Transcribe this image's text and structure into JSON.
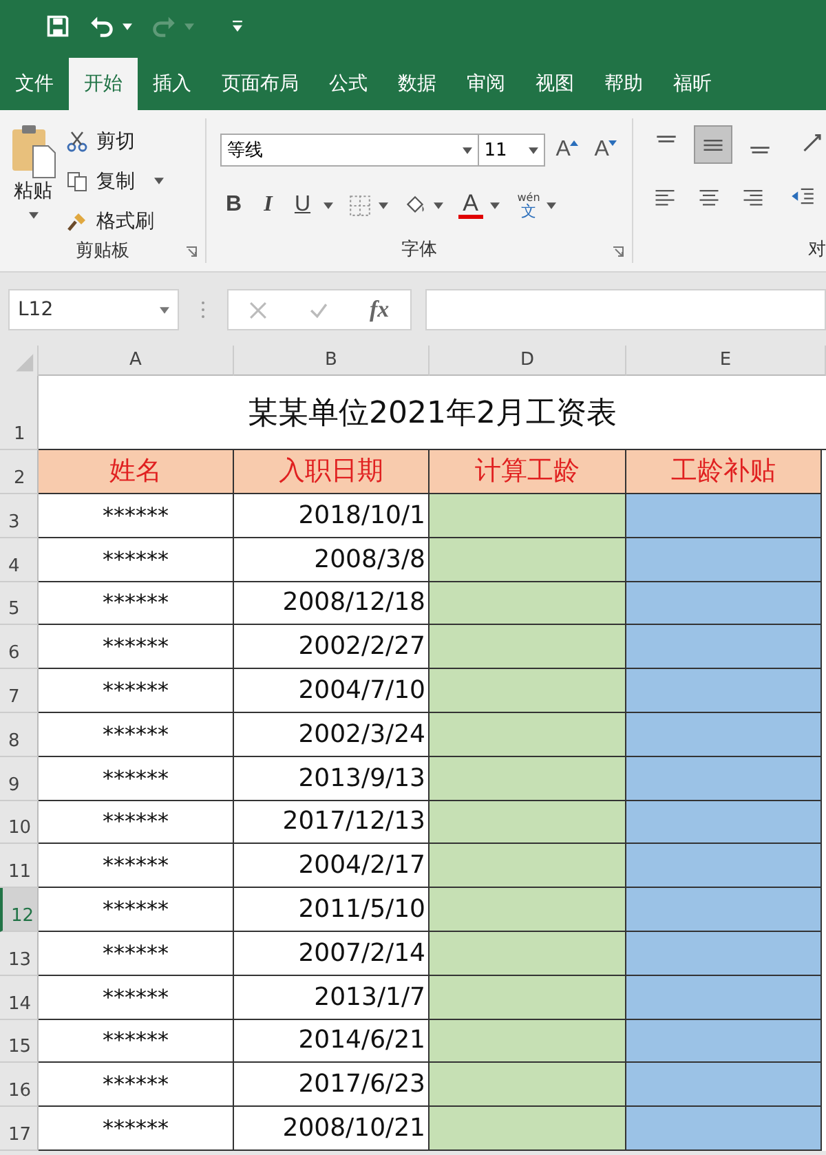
{
  "tabs": [
    {
      "label": "文件",
      "selected": false
    },
    {
      "label": "开始",
      "selected": true
    },
    {
      "label": "插入",
      "selected": false
    },
    {
      "label": "页面布局",
      "selected": false
    },
    {
      "label": "公式",
      "selected": false
    },
    {
      "label": "数据",
      "selected": false
    },
    {
      "label": "审阅",
      "selected": false
    },
    {
      "label": "视图",
      "selected": false
    },
    {
      "label": "帮助",
      "selected": false
    },
    {
      "label": "福昕",
      "selected": false
    }
  ],
  "clipboard": {
    "paste": "粘贴",
    "cut": "剪切",
    "copy": "复制",
    "painter": "格式刷",
    "label": "剪贴板"
  },
  "font": {
    "name": "等线",
    "size": "11",
    "grow": "A",
    "shrink": "A",
    "styles": [
      "B",
      "I",
      "U"
    ],
    "color_letter": "A",
    "phonetic_top": "wén",
    "phonetic_bottom": "文",
    "label": "字体"
  },
  "alignment": {
    "label": "对",
    "top_buttons": [
      {
        "selected": false
      },
      {
        "selected": true
      },
      {
        "selected": false
      }
    ]
  },
  "name_box": "L12",
  "fx": "fx",
  "columns": [
    "A",
    "B",
    "D",
    "E"
  ],
  "title_row": "1",
  "header_row": "2",
  "title": "某某单位2021年2月工资表",
  "headers": [
    "姓名",
    "入职日期",
    "计算工龄",
    "工龄补贴"
  ],
  "rows": [
    {
      "num": "3",
      "name": "******",
      "date": "2018/10/1",
      "selected": false
    },
    {
      "num": "4",
      "name": "******",
      "date": "2008/3/8",
      "selected": false
    },
    {
      "num": "5",
      "name": "******",
      "date": "2008/12/18",
      "selected": false
    },
    {
      "num": "6",
      "name": "******",
      "date": "2002/2/27",
      "selected": false
    },
    {
      "num": "7",
      "name": "******",
      "date": "2004/7/10",
      "selected": false
    },
    {
      "num": "8",
      "name": "******",
      "date": "2002/3/24",
      "selected": false
    },
    {
      "num": "9",
      "name": "******",
      "date": "2013/9/13",
      "selected": false
    },
    {
      "num": "10",
      "name": "******",
      "date": "2017/12/13",
      "selected": false
    },
    {
      "num": "11",
      "name": "******",
      "date": "2004/2/17",
      "selected": false
    },
    {
      "num": "12",
      "name": "******",
      "date": "2011/5/10",
      "selected": true
    },
    {
      "num": "13",
      "name": "******",
      "date": "2007/2/14",
      "selected": false
    },
    {
      "num": "14",
      "name": "******",
      "date": "2013/1/7",
      "selected": false
    },
    {
      "num": "15",
      "name": "******",
      "date": "2014/6/21",
      "selected": false
    },
    {
      "num": "16",
      "name": "******",
      "date": "2017/6/23",
      "selected": false
    },
    {
      "num": "17",
      "name": "******",
      "date": "2008/10/21",
      "selected": false
    }
  ]
}
